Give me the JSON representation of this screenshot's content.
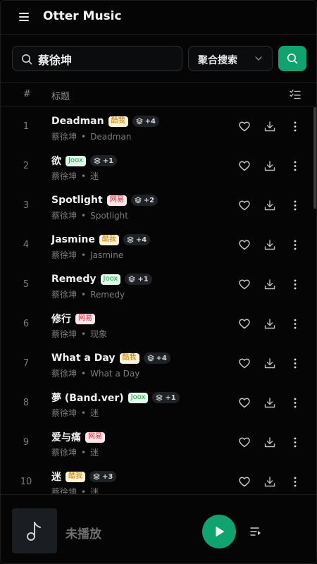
{
  "app": {
    "title": "Otter Music"
  },
  "search": {
    "query": "蔡徐坤",
    "scope": "聚合搜索"
  },
  "table_header": {
    "num": "#",
    "title": "标题"
  },
  "songs": [
    {
      "num": "1",
      "title": "Deadman",
      "source": "酷我",
      "alt": "+4",
      "artist": "蔡徐坤",
      "album": "Deadman"
    },
    {
      "num": "2",
      "title": "欲",
      "source": "Joox",
      "alt": "+1",
      "artist": "蔡徐坤",
      "album": "迷"
    },
    {
      "num": "3",
      "title": "Spotlight",
      "source": "网易",
      "alt": "+2",
      "artist": "蔡徐坤",
      "album": "Spotlight"
    },
    {
      "num": "4",
      "title": "Jasmine",
      "source": "酷我",
      "alt": "+4",
      "artist": "蔡徐坤",
      "album": "Jasmine"
    },
    {
      "num": "5",
      "title": "Remedy",
      "source": "Joox",
      "alt": "+1",
      "artist": "蔡徐坤",
      "album": "Remedy"
    },
    {
      "num": "6",
      "title": "修行",
      "source": "网易",
      "alt": "",
      "artist": "蔡徐坤",
      "album": "现象"
    },
    {
      "num": "7",
      "title": "What a Day",
      "source": "酷我",
      "alt": "+4",
      "artist": "蔡徐坤",
      "album": "What a Day"
    },
    {
      "num": "8",
      "title": "夢 (Band.ver)",
      "source": "Joox",
      "alt": "+1",
      "artist": "蔡徐坤",
      "album": "迷"
    },
    {
      "num": "9",
      "title": "爱与痛",
      "source": "网易",
      "alt": "",
      "artist": "蔡徐坤",
      "album": "迷"
    },
    {
      "num": "10",
      "title": "迷",
      "source": "酷我",
      "alt": "+3",
      "artist": "蔡徐坤",
      "album": "迷"
    }
  ],
  "source_colors": {
    "酷我": {
      "bg": "#fff2d6",
      "fg": "#c97a00"
    },
    "Joox": {
      "bg": "#e2f9e9",
      "fg": "#17a34a"
    },
    "网易": {
      "bg": "#ffe6e8",
      "fg": "#d6303c"
    }
  },
  "player": {
    "status": "未播放"
  },
  "colors": {
    "accent": "#11a36f",
    "background": "#050505"
  },
  "icons": {
    "menu": "menu-icon",
    "search": "search-icon",
    "chevron": "chevron-down-icon",
    "multi_select": "list-check-icon",
    "heart": "heart-icon",
    "download": "download-icon",
    "more": "more-vertical-icon",
    "layers": "layers-icon",
    "music_note": "music-note-icon",
    "play": "play-icon",
    "queue": "queue-icon"
  }
}
